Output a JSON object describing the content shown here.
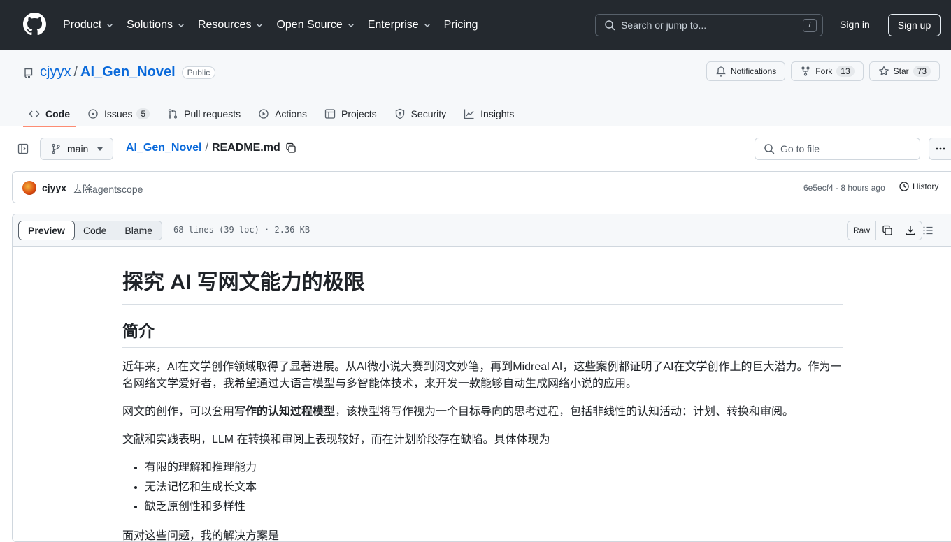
{
  "header": {
    "nav": [
      {
        "label": "Product",
        "has_menu": true
      },
      {
        "label": "Solutions",
        "has_menu": true
      },
      {
        "label": "Resources",
        "has_menu": true
      },
      {
        "label": "Open Source",
        "has_menu": true
      },
      {
        "label": "Enterprise",
        "has_menu": true
      },
      {
        "label": "Pricing",
        "has_menu": false
      }
    ],
    "search_placeholder": "Search or jump to...",
    "search_shortcut": "/",
    "sign_in": "Sign in",
    "sign_up": "Sign up"
  },
  "repo": {
    "owner": "cjyyx",
    "separator": "/",
    "name": "AI_Gen_Novel",
    "visibility": "Public",
    "notifications_label": "Notifications",
    "fork_label": "Fork",
    "fork_count": "13",
    "star_label": "Star",
    "star_count": "73",
    "tabs": [
      {
        "label": "Code",
        "icon": "code-icon"
      },
      {
        "label": "Issues",
        "icon": "issue-icon",
        "count": "5"
      },
      {
        "label": "Pull requests",
        "icon": "pull-request-icon"
      },
      {
        "label": "Actions",
        "icon": "play-icon"
      },
      {
        "label": "Projects",
        "icon": "table-icon"
      },
      {
        "label": "Security",
        "icon": "shield-icon"
      },
      {
        "label": "Insights",
        "icon": "graph-icon"
      }
    ]
  },
  "filenav": {
    "branch": "main",
    "crumb_repo": "AI_Gen_Novel",
    "crumb_sep": "/",
    "crumb_file": "README.md",
    "goto_placeholder": "Go to file"
  },
  "commit": {
    "author": "cjyyx",
    "message": "去除agentscope",
    "hash_time": "6e5ecf4 · 8 hours ago",
    "history_label": "History"
  },
  "file": {
    "views": [
      "Preview",
      "Code",
      "Blame"
    ],
    "info": "68 lines (39 loc) · 2.36 KB",
    "raw_label": "Raw"
  },
  "readme": {
    "title": "探究 AI 写网文能力的极限",
    "section1": "简介",
    "p1": "近年来，AI在文学创作领域取得了显著进展。从AI微小说大赛到阅文妙笔，再到Midreal AI，这些案例都证明了AI在文学创作上的巨大潜力。作为一名网络文学爱好者，我希望通过大语言模型与多智能体技术，来开发一款能够自动生成网络小说的应用。",
    "p2_before": "网文的创作，可以套用",
    "p2_bold": "写作的认知过程模型",
    "p2_after": "，该模型将写作视为一个目标导向的思考过程，包括非线性的认知活动：计划、转换和审阅。",
    "p3": "文献和实践表明，LLM 在转换和审阅上表现较好，而在计划阶段存在缺陷。具体体现为",
    "list": [
      "有限的理解和推理能力",
      "无法记忆和生成长文本",
      "缺乏原创性和多样性"
    ],
    "p4": "面对这些问题，我的解决方案是"
  }
}
